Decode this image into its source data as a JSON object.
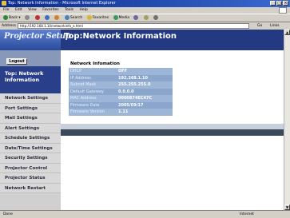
{
  "window": {
    "title": "Top: Network Information - Microsoft Internet Explorer"
  },
  "menu": [
    "File",
    "Edit",
    "View",
    "Favorites",
    "Tools",
    "Help"
  ],
  "toolbar": {
    "back": "Back",
    "search": "Search",
    "favorites": "Favorites",
    "media": "Media"
  },
  "address": {
    "label": "Address",
    "url": "http://192.168.1.10/networkinfo_e.html",
    "go": "Go",
    "links": "Links"
  },
  "page": {
    "brand": "Projector Setup",
    "title": "Top:Network Information",
    "logout": "Logout",
    "active_nav": "Top: Network Information",
    "nav": [
      "Network Settings",
      "Port Settings",
      "Mail Settings",
      "Alert Settings",
      "Schedule Settings",
      "Date/Time Settings",
      "Security Settings",
      "Projector Control",
      "Projector Status",
      "Network Restart"
    ],
    "section_title": "Network Infomation",
    "info": [
      {
        "key": "DHCP",
        "value": "OFF"
      },
      {
        "key": "IP Address",
        "value": "192.168.1.10"
      },
      {
        "key": "Subnet Mask",
        "value": "255.255.255.0"
      },
      {
        "key": "Default Gateway",
        "value": "0.0.0.0"
      },
      {
        "key": "MAC Address",
        "value": "0000874EC47C"
      },
      {
        "key": "Firmware Date",
        "value": "2005/09/17"
      },
      {
        "key": "Firmware Version",
        "value": "1.11"
      }
    ]
  },
  "status": {
    "left": "Done",
    "right": "Internet"
  }
}
